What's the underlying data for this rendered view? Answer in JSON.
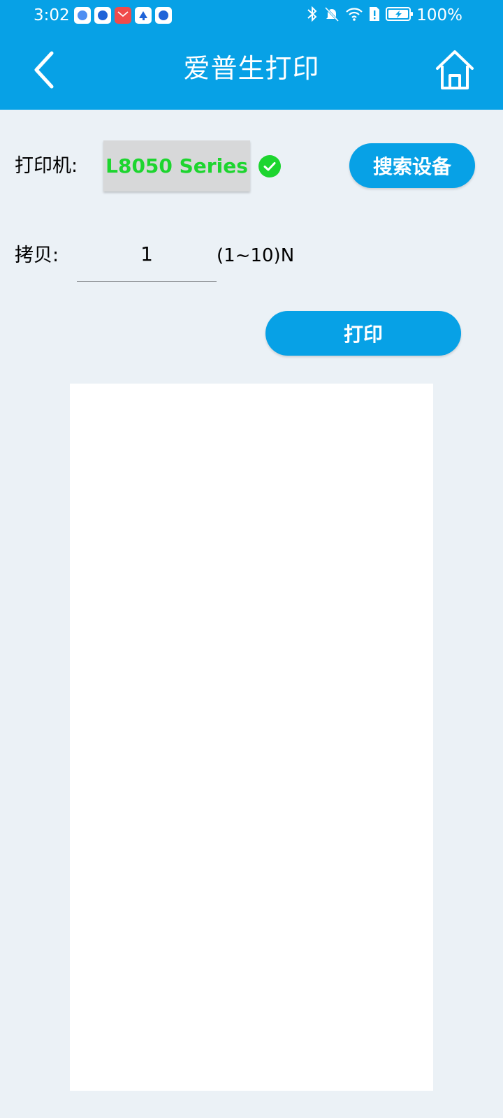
{
  "status_bar": {
    "time": "3:02",
    "battery_percent": "100%",
    "notification_icons": [
      "browser-icon",
      "app-circle-icon",
      "mail-icon",
      "upload-icon",
      "app-circle-icon"
    ],
    "system_icons": [
      "bluetooth-icon",
      "bell-off-icon",
      "wifi-icon",
      "sim-alert-icon",
      "battery-charging-icon"
    ]
  },
  "header": {
    "title": "爱普生打印",
    "back_icon": "chevron-left-icon",
    "home_icon": "home-icon"
  },
  "printer": {
    "label": "打印机:",
    "selected": "L8050 Series",
    "status_icon": "check-circle-icon",
    "search_button": "搜索设备"
  },
  "copies": {
    "label": "拷贝:",
    "value": "1",
    "range_hint": "(1~10)N"
  },
  "actions": {
    "print_button": "打印"
  },
  "colors": {
    "header_bg": "#07a1e6",
    "page_bg": "#ebf1f6",
    "connected_green": "#1dd52f",
    "button_blue": "#07a1e6"
  }
}
